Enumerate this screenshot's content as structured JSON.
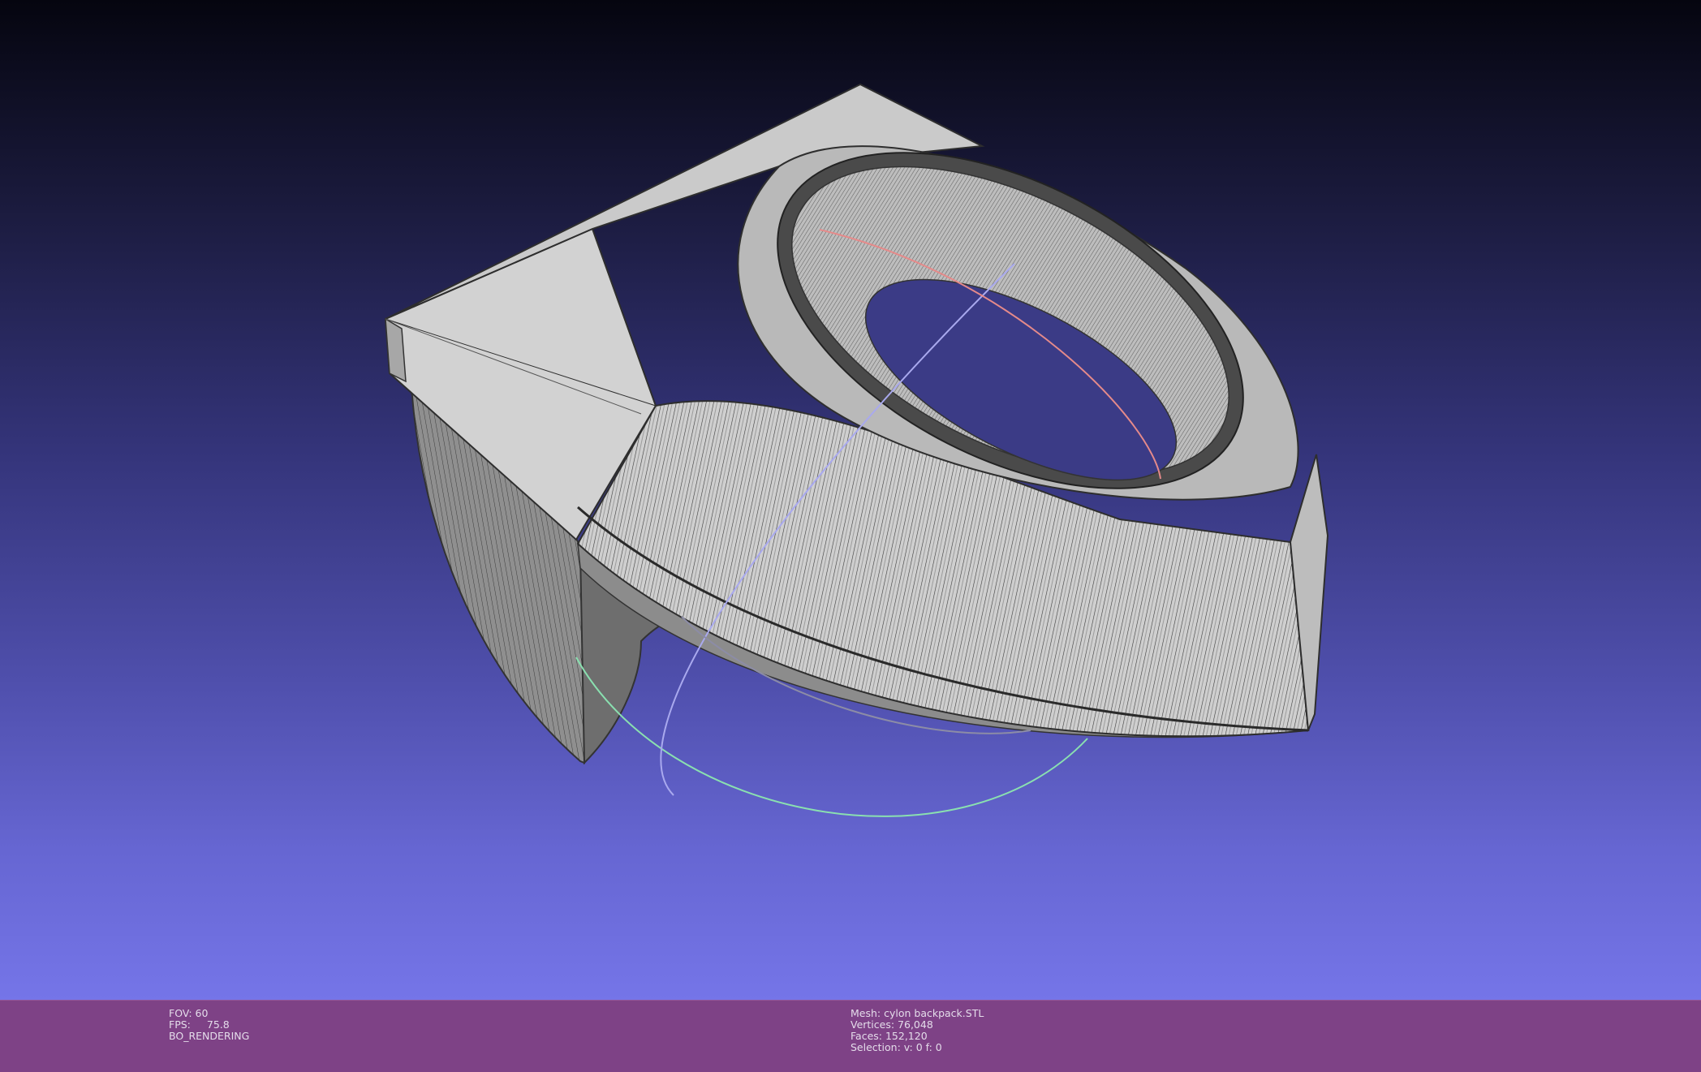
{
  "viewer": {
    "background_top": "#05050f",
    "background_bottom": "#7575e8",
    "mesh_color": "#c9c9c9",
    "wire_color": "#2e2e2e",
    "trackball_colors": {
      "red": "#e58a8a",
      "green": "#8ae0b0",
      "blue": "#a9a9ee",
      "gray": "#8c8ca6"
    }
  },
  "status_bar": {
    "color": "#7e4286",
    "left": {
      "fov": "FOV: 60",
      "fps_label": "FPS:",
      "fps_value": "75.8",
      "rendering_mode": "BO_RENDERING"
    },
    "right": {
      "mesh": "Mesh: cylon backpack.STL",
      "vertices": "Vertices: 76,048",
      "faces": "Faces: 152,120",
      "selection": "Selection: v: 0 f: 0"
    }
  }
}
